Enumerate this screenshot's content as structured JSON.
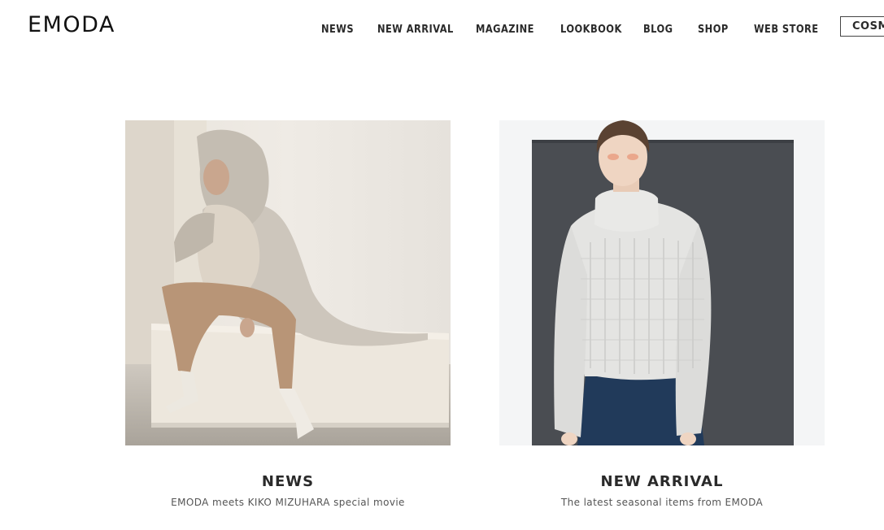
{
  "header": {
    "logo": "EMODA",
    "nav": [
      "NEWS",
      "NEW ARRIVAL",
      "MAGAZINE",
      "LOOKBOOK",
      "BLOG",
      "SHOP",
      "WEB STORE"
    ],
    "cosme_label": "COSME"
  },
  "cards": [
    {
      "title": "NEWS",
      "subtitle": "EMODA meets KIKO MIZUHARA special movie"
    },
    {
      "title": "NEW ARRIVAL",
      "subtitle": "The latest seasonal items from EMODA"
    }
  ],
  "colors": {
    "text": "#2a2a2a",
    "subtext": "#555555",
    "background": "#ffffff"
  }
}
